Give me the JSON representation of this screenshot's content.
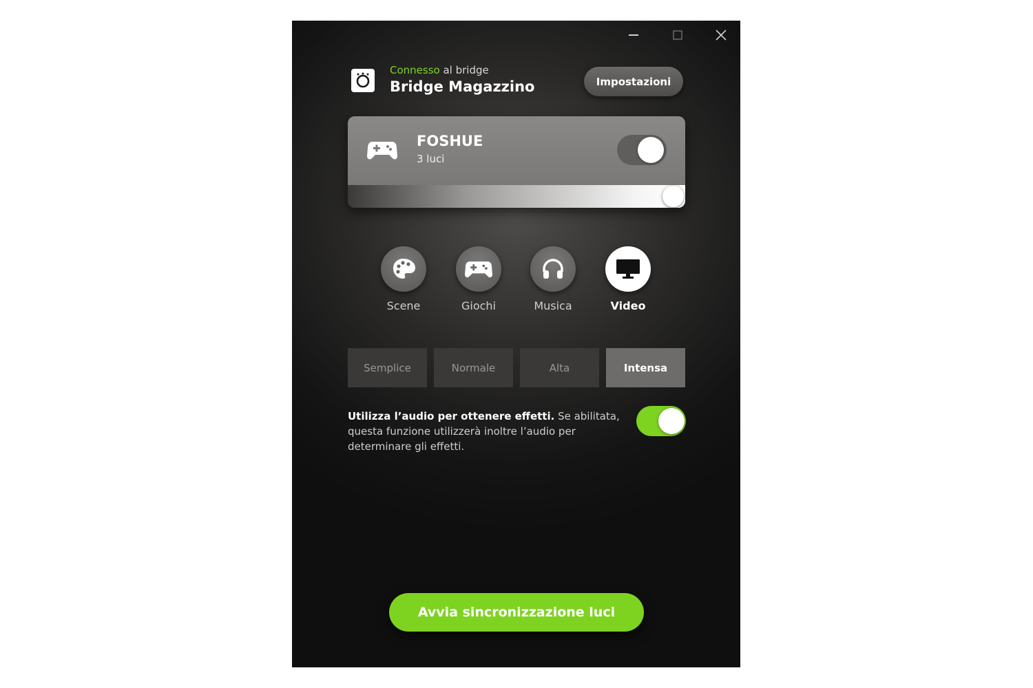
{
  "header": {
    "connected_status": "Connesso",
    "connected_suffix": " al bridge",
    "bridge_name": "Bridge Magazzino",
    "settings_label": "Impostazioni"
  },
  "group": {
    "name": "FOSHUE",
    "subtitle": "3 luci",
    "power_on": true,
    "brightness_percent": 100,
    "icon": "gamepad-icon"
  },
  "modes": [
    {
      "label": "Scene",
      "icon": "palette-icon",
      "active": false
    },
    {
      "label": "Giochi",
      "icon": "gamepad-icon",
      "active": false
    },
    {
      "label": "Musica",
      "icon": "headphones-icon",
      "active": false
    },
    {
      "label": "Video",
      "icon": "monitor-icon",
      "active": true
    }
  ],
  "intensity": {
    "options": [
      "Semplice",
      "Normale",
      "Alta",
      "Intensa"
    ],
    "selected": "Intensa"
  },
  "audio": {
    "title": "Utilizza l’audio per ottenere effetti.",
    "description": " Se abilitata, questa funzione utilizzerà inoltre l’audio per determinare gli effetti.",
    "enabled": true
  },
  "sync_button_label": "Avvia sincronizzazione luci",
  "colors": {
    "accent_green": "#7ed321",
    "background": "#141414"
  }
}
